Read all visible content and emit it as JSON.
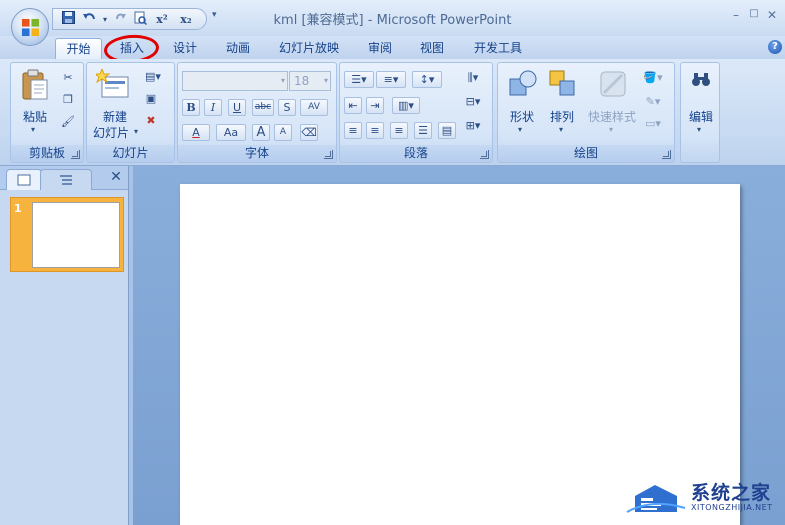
{
  "window": {
    "title": "kml [兼容模式] - Microsoft PowerPoint",
    "controls": {
      "minimize": "–",
      "restore": "□",
      "close": "✕"
    }
  },
  "qat": {
    "save_icon": "save-icon",
    "undo_icon": "undo-icon",
    "redo_icon": "redo-icon",
    "preview_icon": "print-preview-icon",
    "superscript": "x²",
    "subscript": "x₂",
    "customize": "▾"
  },
  "tabs": [
    {
      "label": "开始",
      "active": true
    },
    {
      "label": "插入",
      "active": false
    },
    {
      "label": "设计",
      "active": false
    },
    {
      "label": "动画",
      "active": false
    },
    {
      "label": "幻灯片放映",
      "active": false
    },
    {
      "label": "审阅",
      "active": false
    },
    {
      "label": "视图",
      "active": false
    },
    {
      "label": "开发工具",
      "active": false
    }
  ],
  "help": "?",
  "annotation_color": "#e00000",
  "ribbon": {
    "clipboard": {
      "label": "剪贴板",
      "paste": "粘贴",
      "cut_icon": "scissors-icon",
      "copy_icon": "copy-icon",
      "format_painter_icon": "format-painter-icon"
    },
    "slides": {
      "label": "幻灯片",
      "new_slide_line1": "新建",
      "new_slide_line2": "幻灯片"
    },
    "font": {
      "label": "字体",
      "font_name": "",
      "font_size": "18",
      "bold": "B",
      "italic": "I",
      "underline": "U",
      "strike": "abc",
      "shadow": "S",
      "spacing": "AV",
      "font_color": "A",
      "change_case": "Aa",
      "grow": "A",
      "shrink": "A"
    },
    "paragraph": {
      "label": "段落"
    },
    "drawing": {
      "label": "绘图",
      "shapes": "形状",
      "arrange": "排列",
      "quick_styles": "快速样式"
    },
    "editing": {
      "label": "编辑"
    }
  },
  "slide_panel": {
    "slide_number": "1",
    "close": "✕"
  },
  "watermark": {
    "title": "系统之家",
    "subtitle": "XITONGZHIJIA.NET"
  },
  "colors": {
    "accent": "#15428b",
    "selected_thumb": "#f6b33d",
    "workspace": "#7aa0d1"
  }
}
